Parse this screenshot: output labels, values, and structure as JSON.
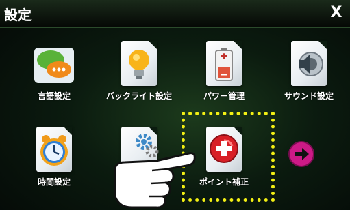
{
  "window": {
    "title": "設定",
    "close_label": "X"
  },
  "tiles": [
    {
      "label": "言語設定",
      "icon": "chat-bubbles-icon"
    },
    {
      "label": "バックライト設定",
      "icon": "lightbulb-icon"
    },
    {
      "label": "パワー管理",
      "icon": "battery-icon"
    },
    {
      "label": "サウンド設定",
      "icon": "speaker-icon"
    },
    {
      "label": "時間設定",
      "icon": "alarm-clock-icon"
    },
    {
      "label": "",
      "icon": "gears-icon"
    },
    {
      "label": "ポイント補正",
      "icon": "plus-circle-icon"
    }
  ],
  "navigation": {
    "next_icon": "arrow-right-icon"
  },
  "overlay": {
    "pointer_icon": "pointing-hand-icon",
    "highlight": "dotted-yellow-frame"
  },
  "colors": {
    "highlight": "#f2ef14",
    "next_button": "#cc1a86",
    "plus_button": "#d81f26"
  }
}
